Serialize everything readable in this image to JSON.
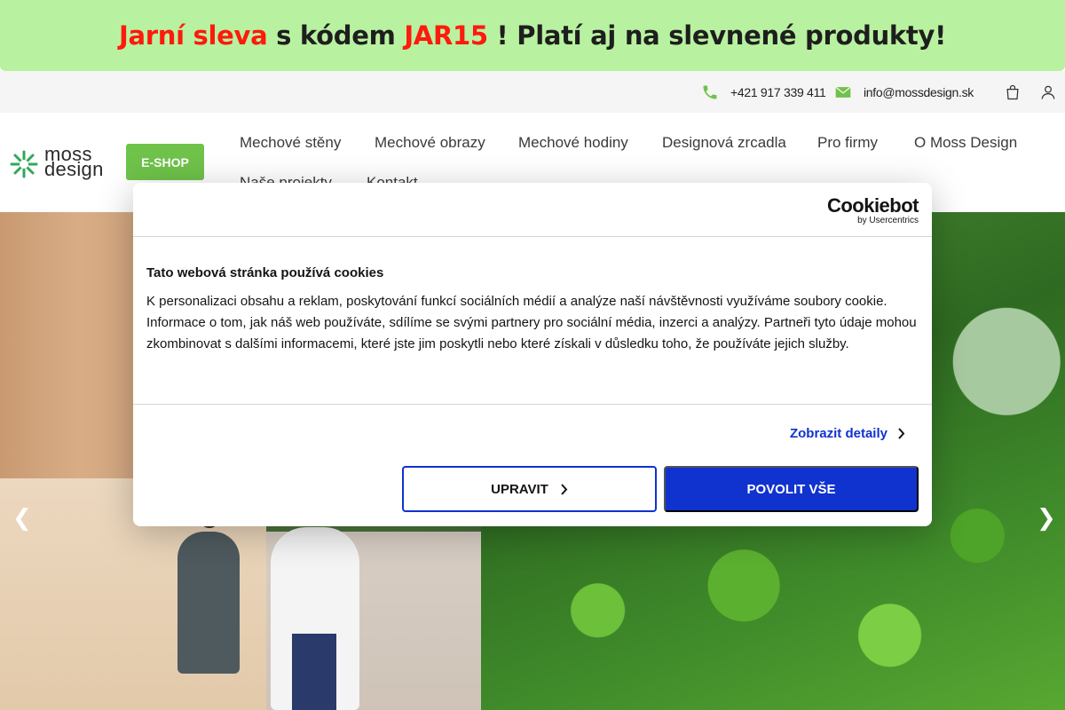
{
  "promo": {
    "part1": "Jarní sleva",
    "part2": " s kódem ",
    "code": "JAR15",
    "part3": " ! Platí aj na slevnené produkty!"
  },
  "topbar": {
    "phone": "+421 917 339 411",
    "email": "info@mossdesign.sk",
    "icons": [
      "phone-icon",
      "envelope-icon",
      "shopping-bag-icon",
      "user-icon"
    ]
  },
  "header": {
    "logo_line1": "moss",
    "logo_line2": "design",
    "eshop_label": "E-SHOP",
    "nav": [
      "Mechové stěny",
      "Mechové obrazy",
      "Mechové hodiny",
      "Designová zrcadla",
      "Pro firmy",
      "O Moss Design",
      "Naše projekty",
      "Kontakt"
    ]
  },
  "slider": {
    "prev_icon": "chevron-left-icon",
    "next_icon": "chevron-right-icon"
  },
  "cookie_dialog": {
    "brand": "Cookiebot",
    "brand_sub": "by Usercentrics",
    "title": "Tato webová stránka používá cookies",
    "text": "K personalizaci obsahu a reklam, poskytování funkcí sociálních médií a analýze naší návštěvnosti využíváme soubory cookie. Informace o tom, jak náš web používáte, sdílíme se svými partnery pro sociální média, inzerci a analýzy. Partneři tyto údaje mohou zkombinovat s dalšími informacemi, které jste jim poskytli nebo které získali v důsledku toho, že používáte jejich služby.",
    "details_label": "Zobrazit detaily",
    "customize_label": "UPRAVIT",
    "allow_all_label": "POVOLIT VŠE",
    "accent_color": "#1032cf"
  },
  "colors": {
    "promo_bg": "#b8f2a0",
    "promo_red": "#ff1a0d",
    "brand_green": "#6fc24a"
  }
}
